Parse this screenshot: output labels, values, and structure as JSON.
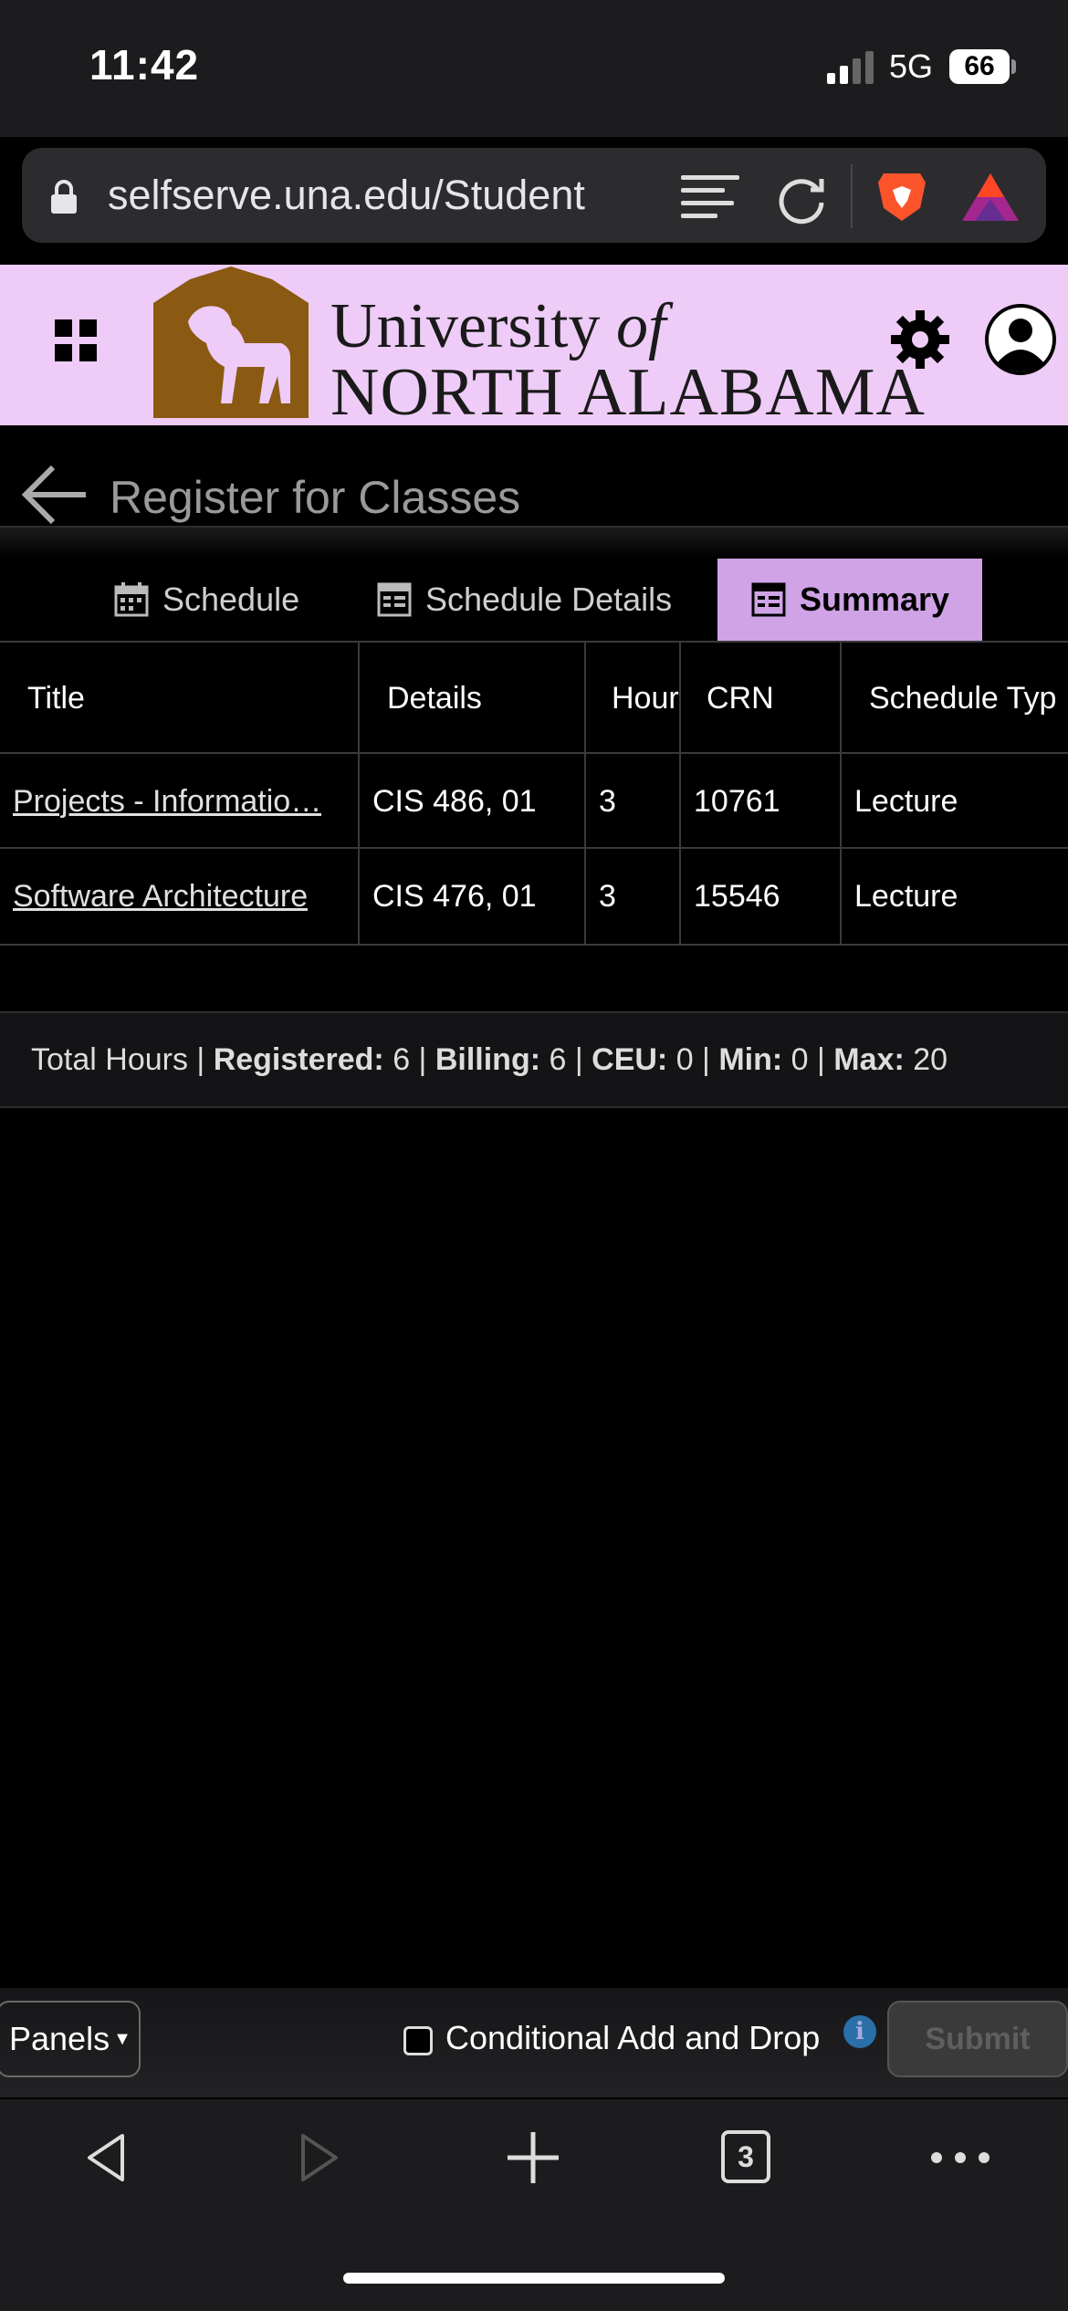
{
  "status_bar": {
    "time": "11:42",
    "network": "5G",
    "battery": "66"
  },
  "browser": {
    "url": "selfserve.una.edu/Student"
  },
  "banner": {
    "line1_a": "University",
    "line1_b": "of",
    "line2": "NORTH ALABAMA"
  },
  "page": {
    "title": "Register for Classes"
  },
  "tabs": [
    {
      "label": "Schedule"
    },
    {
      "label": "Schedule Details"
    },
    {
      "label": "Summary",
      "active": true
    }
  ],
  "table": {
    "headers": [
      "Title",
      "Details",
      "Hour",
      "CRN",
      "Schedule Typ"
    ],
    "rows": [
      {
        "title": "Projects - Informatio…",
        "details": "CIS 486, 01",
        "hours": "3",
        "crn": "10761",
        "schedule_type": "Lecture"
      },
      {
        "title": "Software Architecture",
        "details": "CIS 476, 01",
        "hours": "3",
        "crn": "15546",
        "schedule_type": "Lecture"
      }
    ]
  },
  "totals": {
    "label": "Total Hours | ",
    "registered_label": "Registered:",
    "registered": " 6 | ",
    "billing_label": "Billing:",
    "billing": " 6 | ",
    "ceu_label": "CEU:",
    "ceu": " 0 | ",
    "min_label": "Min:",
    "min": " 0 | ",
    "max_label": "Max:",
    "max": " 20"
  },
  "footer": {
    "panels_label": "Panels",
    "conditional_label": "Conditional Add and Drop",
    "submit_label": "Submit"
  },
  "toolbar": {
    "tab_count": "3"
  },
  "colors": {
    "banner": "#eeccf7",
    "active_tab": "#cfa3e6",
    "logo": "#8a5a12"
  }
}
